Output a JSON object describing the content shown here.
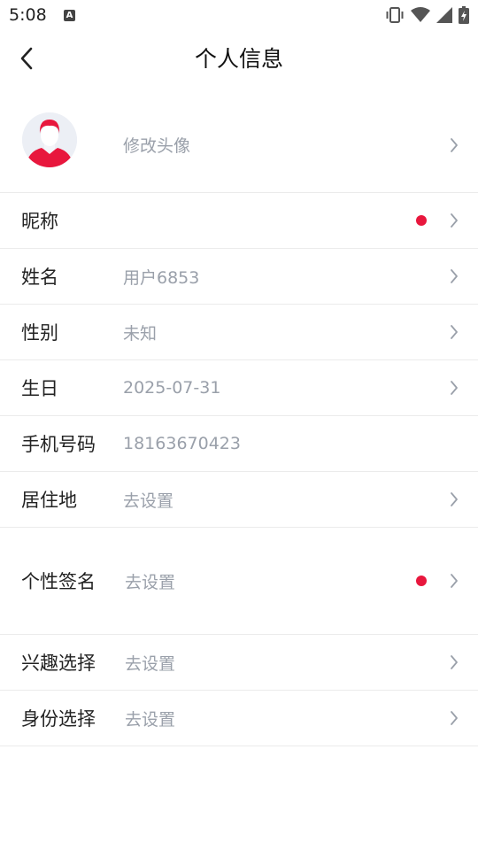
{
  "status_bar": {
    "time": "5:08",
    "icons": [
      "notification-a-icon",
      "vibrate-icon",
      "wifi-icon",
      "signal-icon",
      "battery-charging-icon"
    ]
  },
  "header": {
    "title": "个人信息",
    "back_icon": "chevron-left-icon"
  },
  "colors": {
    "accent_red": "#e8173d",
    "value_gray": "#9aa0aa",
    "divider": "#ebebeb"
  },
  "rows": {
    "avatar": {
      "value": "修改头像"
    },
    "nickname": {
      "label": "昵称",
      "has_dot": true
    },
    "name": {
      "label": "姓名",
      "value": "用户6853"
    },
    "gender": {
      "label": "性别",
      "value": "未知"
    },
    "birthday": {
      "label": "生日",
      "value": "2025-07-31"
    },
    "phone": {
      "label": "手机号码",
      "value": "18163670423"
    },
    "residence": {
      "label": "居住地",
      "value": "去设置"
    },
    "signature": {
      "label": "个性签名",
      "value": "去设置",
      "has_dot": true
    },
    "interests": {
      "label": "兴趣选择",
      "value": "去设置"
    },
    "identity": {
      "label": "身份选择",
      "value": "去设置"
    }
  }
}
